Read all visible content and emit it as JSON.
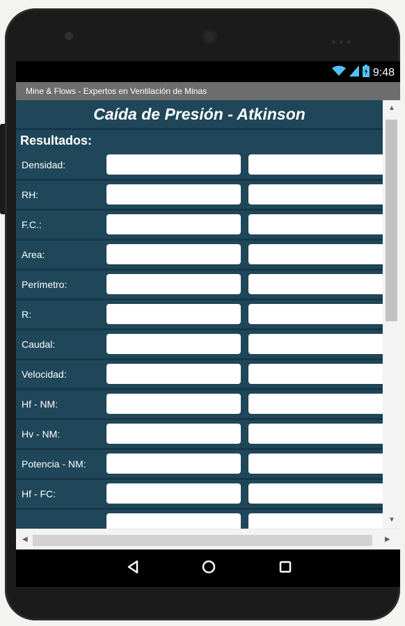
{
  "status": {
    "time": "9:48"
  },
  "window": {
    "title": "Mine & Flows - Expertos en Ventilación de Minas"
  },
  "form": {
    "heading": "Caída de Presión - Atkinson",
    "subheading": "Resultados:",
    "rows": [
      {
        "label": "Densidad:"
      },
      {
        "label": "RH:"
      },
      {
        "label": "F.C.:"
      },
      {
        "label": "Area:"
      },
      {
        "label": "Perímetro:"
      },
      {
        "label": "R:"
      },
      {
        "label": "Caudal:"
      },
      {
        "label": "Velocidad:"
      },
      {
        "label": "Hf - NM:"
      },
      {
        "label": "Hv - NM:"
      },
      {
        "label": "Potencia - NM:"
      },
      {
        "label": "Hf - FC:"
      },
      {
        "label": ""
      }
    ]
  },
  "icons": {
    "wifi": "wifi-icon",
    "signal": "signal-icon",
    "battery": "battery-icon",
    "back": "back-icon",
    "home": "home-icon",
    "recents": "recents-icon"
  },
  "colors": {
    "panel": "#1f4759",
    "divider": "#163748",
    "titlebar": "#6d6d6d",
    "field": "#ffffff"
  }
}
